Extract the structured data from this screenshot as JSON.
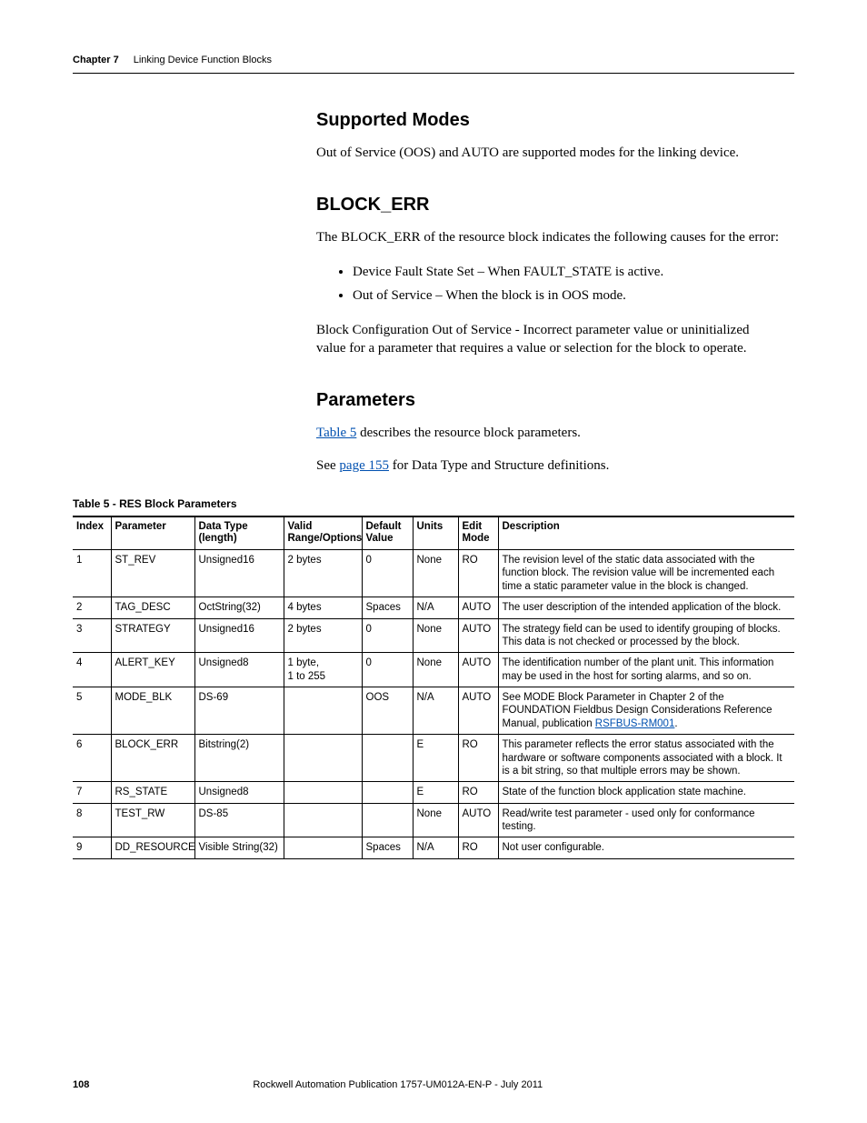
{
  "header": {
    "chapter": "Chapter 7",
    "title": "Linking Device Function Blocks"
  },
  "sections": {
    "supported_modes": {
      "heading": "Supported Modes",
      "p1": "Out of Service (OOS) and AUTO are supported modes for the linking device."
    },
    "block_err": {
      "heading": "BLOCK_ERR",
      "p1": "The BLOCK_ERR of the resource block indicates the following causes for the error:",
      "bullets": [
        "Device Fault State Set – When FAULT_STATE is active.",
        "Out of Service – When the block is in OOS mode."
      ],
      "p2": "Block Configuration Out of Service - Incorrect parameter value or uninitialized value for a parameter that requires a value or selection for the block to operate."
    },
    "parameters": {
      "heading": "Parameters",
      "p1a": "",
      "table_link": "Table 5",
      "p1b": " describes the resource block parameters.",
      "p2a": "See ",
      "page_link": "page 155",
      "p2b": " for Data Type and Structure definitions."
    }
  },
  "table": {
    "caption": "Table 5 - RES Block Parameters",
    "headers": {
      "index": "Index",
      "parameter": "Parameter",
      "data_type": "Data Type (length)",
      "range": "Valid Range/Options",
      "default": "Default Value",
      "units": "Units",
      "mode": "Edit Mode",
      "desc": "Description"
    },
    "rows": [
      {
        "index": "1",
        "parameter": "ST_REV",
        "data_type": "Unsigned16",
        "range": "2 bytes",
        "default": "0",
        "units": "None",
        "mode": "RO",
        "desc": "The revision level of the static data associated with the function block. The revision value will be incremented each time a static parameter value in the block is changed."
      },
      {
        "index": "2",
        "parameter": "TAG_DESC",
        "data_type": "OctString(32)",
        "range": "4 bytes",
        "default": "Spaces",
        "units": "N/A",
        "mode": "AUTO",
        "desc": "The user description of the intended application of the block."
      },
      {
        "index": "3",
        "parameter": "STRATEGY",
        "data_type": "Unsigned16",
        "range": "2 bytes",
        "default": "0",
        "units": "None",
        "mode": "AUTO",
        "desc": "The strategy field can be used to identify grouping of blocks. This data is not checked or processed by the block."
      },
      {
        "index": "4",
        "parameter": "ALERT_KEY",
        "data_type": "Unsigned8",
        "range": "1 byte,\n1 to 255",
        "default": "0",
        "units": "None",
        "mode": "AUTO",
        "desc": "The identification number of the plant unit. This information may be used in the host for sorting alarms, and so on."
      },
      {
        "index": "5",
        "parameter": "MODE_BLK",
        "data_type": "DS-69",
        "range": "",
        "default": "OOS",
        "units": "N/A",
        "mode": "AUTO",
        "desc_pre": "See MODE Block Parameter in Chapter 2 of the FOUNDATION Fieldbus Design Considerations Reference Manual, publication ",
        "desc_link": "RSFBUS-RM001",
        "desc_post": "."
      },
      {
        "index": "6",
        "parameter": "BLOCK_ERR",
        "data_type": "Bitstring(2)",
        "range": "",
        "default": "",
        "units": "E",
        "mode": "RO",
        "desc": "This parameter reflects the error status associated with the hardware or software components associated with a block. It is a bit string, so that multiple errors may be shown."
      },
      {
        "index": "7",
        "parameter": "RS_STATE",
        "data_type": "Unsigned8",
        "range": "",
        "default": "",
        "units": "E",
        "mode": "RO",
        "desc": "State of the function block application state machine."
      },
      {
        "index": "8",
        "parameter": "TEST_RW",
        "data_type": "DS-85",
        "range": "",
        "default": "",
        "units": "None",
        "mode": "AUTO",
        "desc": "Read/write test parameter - used only for conformance testing."
      },
      {
        "index": "9",
        "parameter": "DD_RESOURCE",
        "data_type": "Visible String(32)",
        "range": "",
        "default": "Spaces",
        "units": "N/A",
        "mode": "RO",
        "desc": "Not user configurable."
      }
    ]
  },
  "footer": {
    "page_number": "108",
    "pub": "Rockwell Automation Publication 1757-UM012A-EN-P - July 2011"
  }
}
